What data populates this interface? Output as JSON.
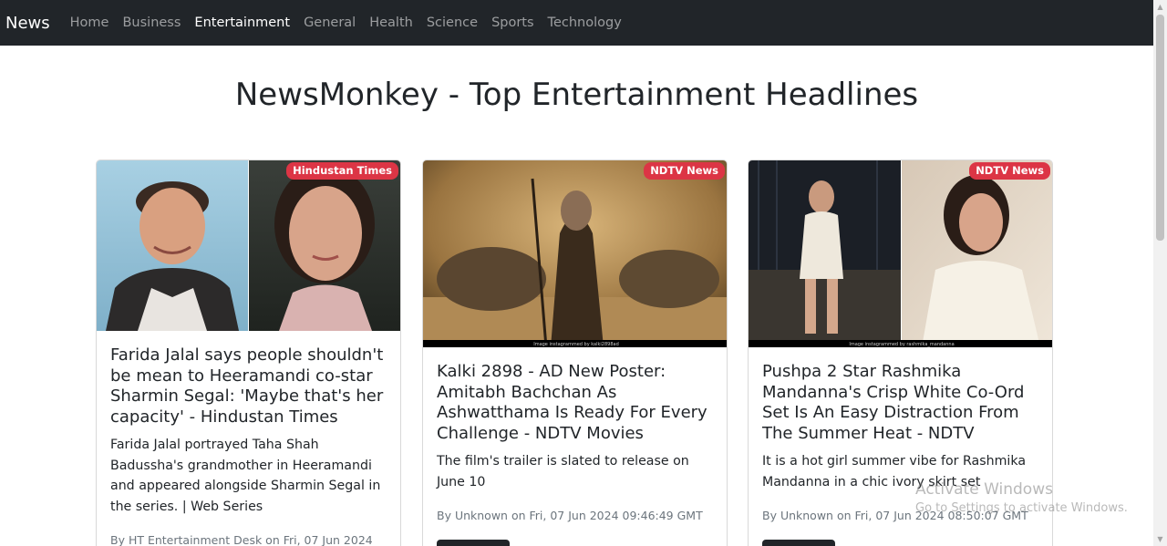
{
  "navbar": {
    "brand": "News",
    "links": [
      "Home",
      "Business",
      "Entertainment",
      "General",
      "Health",
      "Science",
      "Sports",
      "Technology"
    ],
    "active": "Entertainment"
  },
  "page_title": "NewsMonkey - Top Entertainment Headlines",
  "articles": [
    {
      "source": "Hindustan Times",
      "title": "Farida Jalal says people shouldn't be mean to Heeramandi co-star Sharmin Segal: 'Maybe that's her capacity' - Hindustan Times",
      "description": "Farida Jalal portrayed Taha Shah Badussha's grandmother in Heeramandi and appeared alongside Sharmin Segal in the series. | Web Series",
      "meta": "By HT Entertainment Desk on Fri, 07 Jun 2024"
    },
    {
      "source": "NDTV News",
      "title": "Kalki 2898 - AD New Poster: Amitabh Bachchan As Ashwatthama Is Ready For Every Challenge - NDTV Movies",
      "description": "The film's trailer is slated to release on June 10",
      "meta": "By Unknown on Fri, 07 Jun 2024 09:46:49 GMT",
      "image_caption": "Image instagrammed by kalki2898ad"
    },
    {
      "source": "NDTV News",
      "title": "Pushpa 2 Star Rashmika Mandanna's Crisp White Co-Ord Set Is An Easy Distraction From The Summer Heat - NDTV",
      "description": "It is a hot girl summer vibe for Rashmika Mandanna in a chic ivory skirt set",
      "meta": "By Unknown on Fri, 07 Jun 2024 08:50:07 GMT",
      "image_caption": "Image instagrammed by rashmika_mandanna"
    }
  ],
  "watermark": {
    "title": "Activate Windows",
    "subtitle": "Go to Settings to activate Windows."
  },
  "colors": {
    "navbar_bg": "#212529",
    "badge": "#dc3545",
    "button": "#212529"
  }
}
